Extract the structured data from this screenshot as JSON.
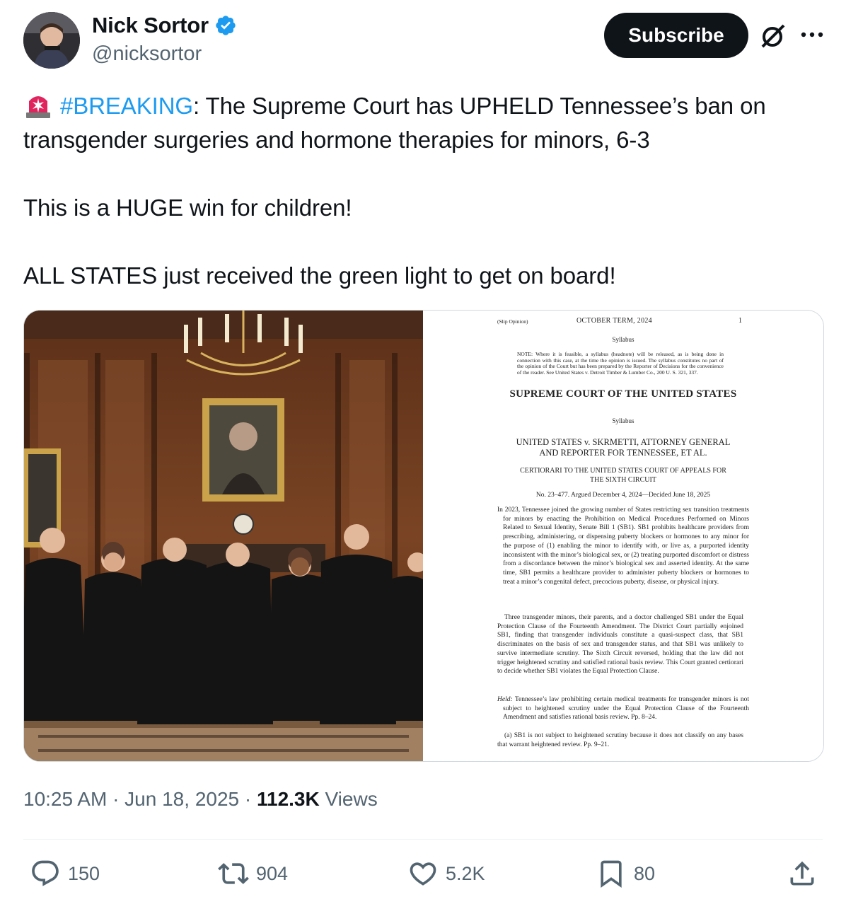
{
  "author": {
    "name": "Nick Sortor",
    "handle": "@nicksortor",
    "verified_color": "#1d9bf0"
  },
  "header": {
    "subscribe_label": "Subscribe",
    "grok_icon": "grok-icon",
    "more_icon": "more-icon"
  },
  "tweet": {
    "emoji": "🚨",
    "hashtag": "#BREAKING",
    "line1_rest": ": The Supreme Court has UPHELD Tennessee’s ban on transgender surgeries and hormone therapies for minors, 6-3",
    "line2": "This is a HUGE win for children!",
    "line3": "ALL STATES just received the green light to get on board!"
  },
  "document": {
    "slip": "(Slip Opinion)",
    "term": "OCTOBER TERM, 2024",
    "page": "1",
    "syllabus1": "Syllabus",
    "note": "NOTE: Where it is feasible, a syllabus (headnote) will be released, as is being done in connection with this case, at the time the opinion is issued. The syllabus constitutes no part of the opinion of the Court but has been prepared by the Reporter of Decisions for the convenience of the reader. See United States v. Detroit Timber & Lumber Co., 200 U. S. 321, 337.",
    "court": "SUPREME COURT OF THE UNITED STATES",
    "syllabus2": "Syllabus",
    "case_line1": "UNITED STATES v. SKRMETTI, ATTORNEY GENERAL",
    "case_line2": "AND REPORTER FOR TENNESSEE, ET AL.",
    "cert_line1": "CERTIORARI TO THE UNITED STATES COURT OF APPEALS FOR",
    "cert_line2": "THE SIXTH CIRCUIT",
    "docket": "No. 23–477.   Argued December 4, 2024—Decided June 18, 2025",
    "para1": "In 2023, Tennessee joined the growing number of States restricting sex transition treatments for minors by enacting the Prohibition on Medical Procedures Performed on Minors Related to Sexual Identity, Senate Bill 1 (SB1). SB1 prohibits healthcare providers from prescribing, administering, or dispensing puberty blockers or hormones to any minor for the purpose of (1) enabling the minor to identify with, or live as, a purported identity inconsistent with the minor’s biological sex, or (2) treating purported discomfort or distress from a discordance between the minor’s biological sex and asserted identity. At the same time, SB1 permits a healthcare provider to administer puberty blockers or hormones to treat a minor’s congenital defect, precocious puberty, disease, or physical injury.",
    "para2": "Three transgender minors, their parents, and a doctor challenged SB1 under the Equal Protection Clause of the Fourteenth Amendment. The District Court partially enjoined SB1, finding that transgender individuals constitute a quasi-suspect class, that SB1 discriminates on the basis of sex and transgender status, and that SB1 was unlikely to survive intermediate scrutiny. The Sixth Circuit reversed, holding that the law did not trigger heightened scrutiny and satisfied rational basis review. This Court granted certiorari to decide whether SB1 violates the Equal Protection Clause.",
    "held_label": "Held:",
    "para3": " Tennessee’s law prohibiting certain medical treatments for transgender minors is not subject to heightened scrutiny under the Equal Protection Clause of the Fourteenth Amendment and satisfies rational basis review. Pp. 8–24.",
    "para4": "(a) SB1 is not subject to heightened scrutiny because it does not classify on any bases that warrant heightened review. Pp. 9–21."
  },
  "meta": {
    "time": "10:25 AM · Jun 18, 2025 · ",
    "views_count": "112.3K",
    "views_label": " Views"
  },
  "actions": {
    "replies": "150",
    "reposts": "904",
    "likes": "5.2K",
    "bookmarks": "80"
  }
}
